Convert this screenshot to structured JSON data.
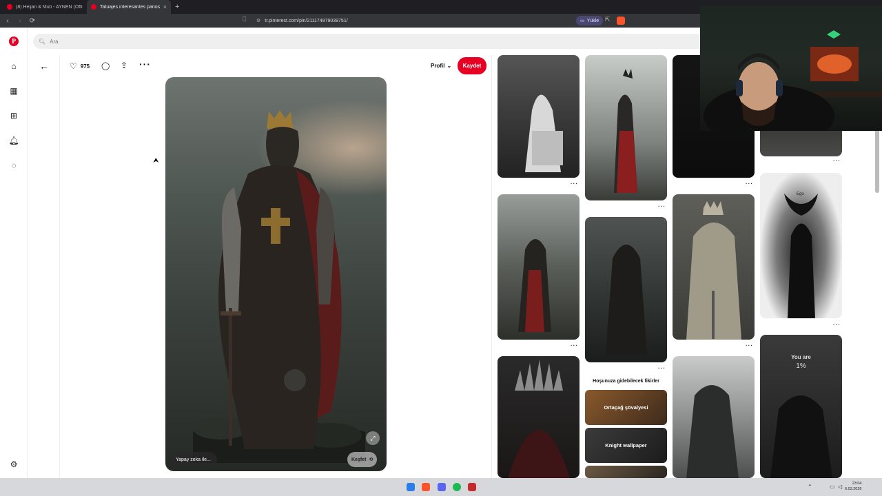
{
  "browser": {
    "tabs": [
      {
        "title": "(8) Heijan & Muti - AYNEN (Official V"
      },
      {
        "title": "Tatuajes interesantes panosunda"
      }
    ],
    "new_tab": "+",
    "url": "tr.pinterest.com/pin/211174979039751/",
    "install_label": "Yükle"
  },
  "search": {
    "placeholder": "Ara"
  },
  "pin": {
    "like_count": "975",
    "profile_label": "Profil",
    "save_label": "Kaydet",
    "ai_badge": "Yapay zeka ile...",
    "explore_label": "Keşfet"
  },
  "ideas": {
    "title": "Hoşunuza gidebilecek fikirler",
    "items": [
      "Ortaçağ şövalyesi",
      "Knight wallpaper"
    ]
  },
  "grid_text": {
    "ego": "Ego",
    "you_are": "You are",
    "percent": "1%"
  },
  "taskbar": {
    "time": "23:04",
    "date": "6.03.2026"
  },
  "colors": {
    "brand": "#e60023",
    "install_pill": "#4a4773"
  }
}
